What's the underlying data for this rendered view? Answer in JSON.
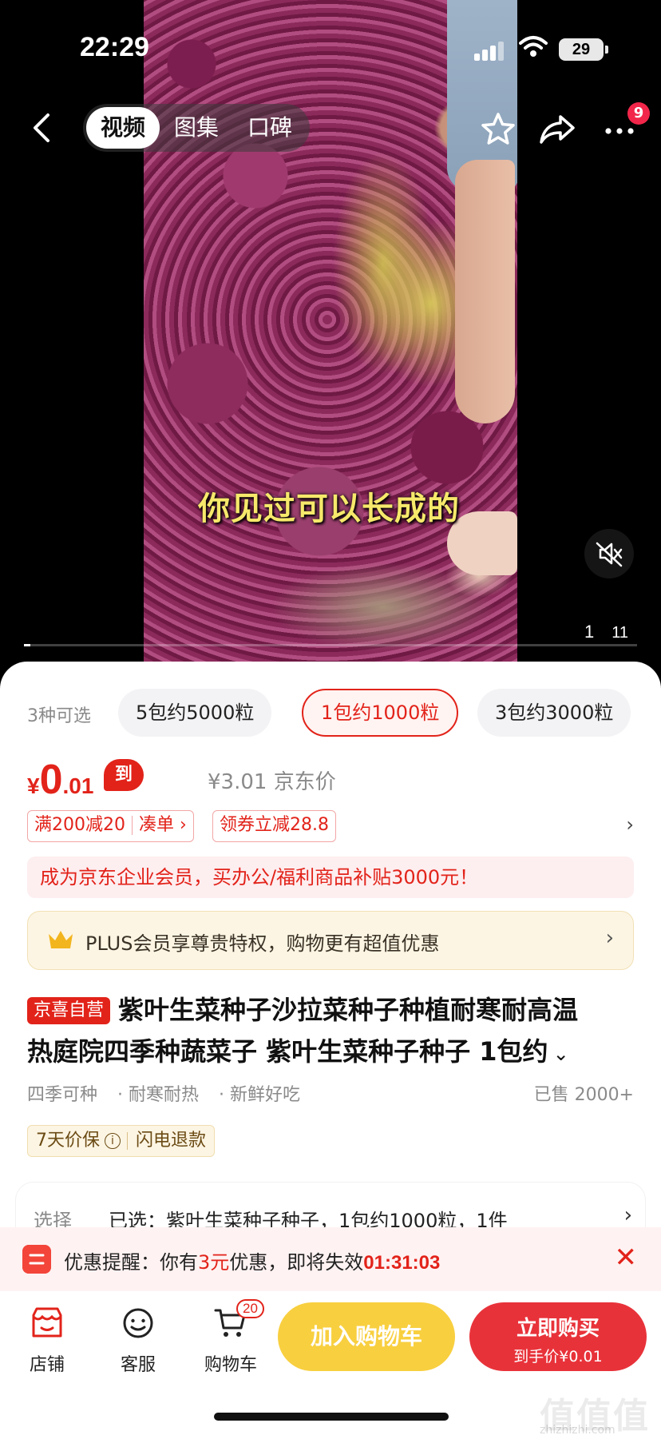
{
  "status_bar": {
    "time": "22:29",
    "battery": "29"
  },
  "header": {
    "tabs": [
      {
        "label": "视频",
        "active": true
      },
      {
        "label": "图集",
        "active": false
      },
      {
        "label": "口碑",
        "active": false
      }
    ],
    "more_badge": "9"
  },
  "video": {
    "subtitle": "你见过可以长成的",
    "page_current": "1",
    "page_total": "11",
    "progress": 0.01
  },
  "variants": {
    "count_label": "3种可选",
    "options": [
      {
        "label": "5包约5000粒",
        "selected": false
      },
      {
        "label": "1包约1000粒",
        "selected": true
      },
      {
        "label": "3包约3000粒",
        "selected": false
      }
    ]
  },
  "price": {
    "currency": "¥",
    "integer": "0",
    "decimal": ".01",
    "tag": "到手价",
    "original": "¥3.01 京东价"
  },
  "promos": {
    "full_reduce": "满200减20",
    "combine": "凑单 ›",
    "coupon": "领券立减28.8",
    "arrow": "›"
  },
  "biz_banner": "成为京东企业会员，买办公/福利商品补贴3000元！",
  "plus_banner": {
    "text": "PLUS会员享尊贵特权，购物更有超值优惠",
    "arrow": "›"
  },
  "product": {
    "badge": "京喜自营",
    "title_line1": "紫叶生菜种子沙拉菜种子种植耐寒耐高温",
    "title_line2": "热庭院四季种蔬菜子 紫叶生菜种子种子 1包约",
    "expand_icon": "⌄",
    "tags": [
      "四季可种",
      "· 耐寒耐热",
      "· 新鲜好吃"
    ],
    "sold": "已售 2000+"
  },
  "guarantee": {
    "price_protect": "7天价保",
    "info_icon": "i",
    "refund": "闪电退款"
  },
  "selection": {
    "label": "选择",
    "value": "已选：紫叶生菜种子种子，1包约1000粒，1件",
    "arrow": "›"
  },
  "reminder": {
    "prefix": "优惠提醒：你有",
    "amount": "3元",
    "middle": "优惠，即将失效",
    "countdown": "01:31:03",
    "close": "✕"
  },
  "bottom_bar": {
    "store": "店铺",
    "service": "客服",
    "cart": "购物车",
    "cart_count": "20",
    "add_to_cart": "加入购物车",
    "buy_now": "立即购买",
    "buy_now_price": "到手价¥0.01"
  },
  "watermark": {
    "brand": "值值值",
    "url": "zhizhizhi.com"
  },
  "colors": {
    "accent_red": "#e2231a",
    "cart_yellow": "#f8cf3f",
    "buy_red": "#e8323a"
  }
}
